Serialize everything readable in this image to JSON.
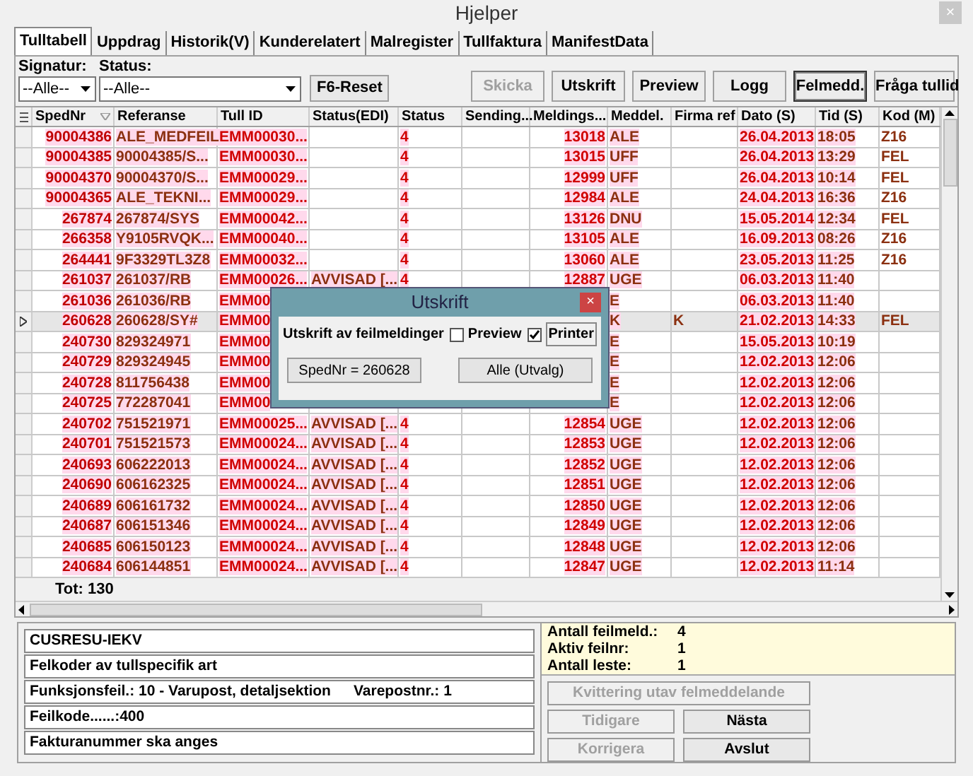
{
  "window": {
    "title": "Hjelper",
    "close": "×"
  },
  "tabs": [
    {
      "label": "Tulltabell",
      "selected": true
    },
    {
      "label": "Uppdrag",
      "selected": false
    },
    {
      "label": "Historik(V)",
      "selected": false
    },
    {
      "label": "Kunderelatert",
      "selected": false
    },
    {
      "label": "Malregister",
      "selected": false
    },
    {
      "label": "Tullfaktura",
      "selected": false
    },
    {
      "label": "ManifestData",
      "selected": false
    }
  ],
  "filters": {
    "signatur": {
      "label": "Signatur:",
      "value": "--Alle--"
    },
    "status": {
      "label": "Status:",
      "value": "--Alle--"
    },
    "reset_button": "F6-Reset"
  },
  "toolbar": [
    {
      "label": "Skicka",
      "disabled": true,
      "pressed": false
    },
    {
      "label": "Utskrift",
      "disabled": false,
      "pressed": false
    },
    {
      "label": "Preview",
      "disabled": false,
      "pressed": false
    },
    {
      "label": "Logg",
      "disabled": false,
      "pressed": false
    },
    {
      "label": "Felmedd.",
      "disabled": false,
      "pressed": true
    },
    {
      "label": "Fråga tullid",
      "disabled": false,
      "pressed": false
    }
  ],
  "table": {
    "columns": [
      "SpedNr",
      "Referanse",
      "Tull ID",
      "Status(EDI)",
      "Status",
      "Sending...",
      "Meldings...",
      "Meddel.",
      "Firma ref",
      "Dato (S)",
      "Tid (S)",
      "Kod (M)"
    ],
    "rows": [
      {
        "selected": false,
        "sped_nr": "90004386",
        "referanse": "ALE_MEDFEIL",
        "tull_id": "EMM00030...",
        "status": "4",
        "meldings": "13018",
        "meddel": "ALE",
        "dato": "26.04.2013",
        "tid": "18:05",
        "kod": "Z16"
      },
      {
        "selected": false,
        "sped_nr": "90004385",
        "referanse": "90004385/S...",
        "tull_id": "EMM00030...",
        "status": "4",
        "meldings": "13015",
        "meddel": "UFF",
        "dato": "26.04.2013",
        "tid": "13:29",
        "kod": "FEL"
      },
      {
        "selected": false,
        "sped_nr": "90004370",
        "referanse": "90004370/S...",
        "tull_id": "EMM00029...",
        "status": "4",
        "meldings": "12999",
        "meddel": "UFF",
        "dato": "26.04.2013",
        "tid": "10:14",
        "kod": "FEL"
      },
      {
        "selected": false,
        "sped_nr": "90004365",
        "referanse": "ALE_TEKNI...",
        "tull_id": "EMM00029...",
        "status": "4",
        "meldings": "12984",
        "meddel": "ALE",
        "dato": "24.04.2013",
        "tid": "16:36",
        "kod": "Z16"
      },
      {
        "selected": false,
        "sped_nr": "267874",
        "referanse": "267874/SYS",
        "tull_id": "EMM00042...",
        "status": "4",
        "meldings": "13126",
        "meddel": "DNU",
        "dato": "15.05.2014",
        "tid": "12:34",
        "kod": "FEL"
      },
      {
        "selected": false,
        "sped_nr": "266358",
        "referanse": "Y9105RVQK...",
        "tull_id": "EMM00040...",
        "status": "4",
        "meldings": "13105",
        "meddel": "ALE",
        "dato": "16.09.2013",
        "tid": "08:26",
        "kod": "Z16"
      },
      {
        "selected": false,
        "sped_nr": "264441",
        "referanse": "9F3329TL3Z8",
        "tull_id": "EMM00032...",
        "status": "4",
        "meldings": "13060",
        "meddel": "ALE",
        "dato": "23.05.2013",
        "tid": "11:25",
        "kod": "Z16"
      },
      {
        "selected": false,
        "sped_nr": "261037",
        "referanse": "261037/RB",
        "tull_id": "EMM00026...",
        "status_edi": "AVVISAD [...",
        "status": "4",
        "meldings": "12887",
        "meddel": "UGE",
        "dato": "06.03.2013",
        "tid": "11:40"
      },
      {
        "selected": false,
        "sped_nr": "261036",
        "referanse": "261036/RB",
        "tull_id": "EMM00",
        "meddel": "E",
        "dato": "06.03.2013",
        "tid": "11:40"
      },
      {
        "selected": true,
        "sped_nr": "260628",
        "referanse": "260628/SY#",
        "tull_id": "EMM00",
        "meddel": "K",
        "firma_ref": "K",
        "dato": "21.02.2013",
        "tid": "14:33",
        "kod": "FEL"
      },
      {
        "selected": false,
        "sped_nr": "240730",
        "referanse": "829324971",
        "tull_id": "EMM00",
        "meddel": "E",
        "dato": "15.05.2013",
        "tid": "10:19"
      },
      {
        "selected": false,
        "sped_nr": "240729",
        "referanse": "829324945",
        "tull_id": "EMM00",
        "meddel": "E",
        "dato": "12.02.2013",
        "tid": "12:06"
      },
      {
        "selected": false,
        "sped_nr": "240728",
        "referanse": "811756438",
        "tull_id": "EMM00",
        "meddel": "E",
        "dato": "12.02.2013",
        "tid": "12:06"
      },
      {
        "selected": false,
        "sped_nr": "240725",
        "referanse": "772287041",
        "tull_id": "EMM00",
        "meddel": "E",
        "dato": "12.02.2013",
        "tid": "12:06"
      },
      {
        "selected": false,
        "sped_nr": "240702",
        "referanse": "751521971",
        "tull_id": "EMM00025...",
        "status_edi": "AVVISAD [...",
        "status": "4",
        "meldings": "12854",
        "meddel": "UGE",
        "dato": "12.02.2013",
        "tid": "12:06"
      },
      {
        "selected": false,
        "sped_nr": "240701",
        "referanse": "751521573",
        "tull_id": "EMM00024...",
        "status_edi": "AVVISAD [...",
        "status": "4",
        "meldings": "12853",
        "meddel": "UGE",
        "dato": "12.02.2013",
        "tid": "12:06"
      },
      {
        "selected": false,
        "sped_nr": "240693",
        "referanse": "606222013",
        "tull_id": "EMM00024...",
        "status_edi": "AVVISAD [...",
        "status": "4",
        "meldings": "12852",
        "meddel": "UGE",
        "dato": "12.02.2013",
        "tid": "12:06"
      },
      {
        "selected": false,
        "sped_nr": "240690",
        "referanse": "606162325",
        "tull_id": "EMM00024...",
        "status_edi": "AVVISAD [...",
        "status": "4",
        "meldings": "12851",
        "meddel": "UGE",
        "dato": "12.02.2013",
        "tid": "12:06"
      },
      {
        "selected": false,
        "sped_nr": "240689",
        "referanse": "606161732",
        "tull_id": "EMM00024...",
        "status_edi": "AVVISAD [...",
        "status": "4",
        "meldings": "12850",
        "meddel": "UGE",
        "dato": "12.02.2013",
        "tid": "12:06"
      },
      {
        "selected": false,
        "sped_nr": "240687",
        "referanse": "606151346",
        "tull_id": "EMM00024...",
        "status_edi": "AVVISAD [...",
        "status": "4",
        "meldings": "12849",
        "meddel": "UGE",
        "dato": "12.02.2013",
        "tid": "12:06"
      },
      {
        "selected": false,
        "sped_nr": "240685",
        "referanse": "606150123",
        "tull_id": "EMM00024...",
        "status_edi": "AVVISAD [...",
        "status": "4",
        "meldings": "12848",
        "meddel": "UGE",
        "dato": "12.02.2013",
        "tid": "12:06"
      },
      {
        "selected": false,
        "sped_nr": "240684",
        "referanse": "606144851",
        "tull_id": "EMM00024...",
        "status_edi": "AVVISAD [...",
        "status": "4",
        "meldings": "12847",
        "meddel": "UGE",
        "dato": "12.02.2013",
        "tid": "11:14"
      }
    ],
    "total": "Tot: 130"
  },
  "dialog": {
    "title": "Utskrift",
    "close": "×",
    "label": "Utskrift av feilmeldinger",
    "options": [
      {
        "label": "Preview",
        "checked": false
      },
      {
        "label": "Printer",
        "checked": true
      }
    ],
    "buttons": [
      "SpedNr = 260628",
      "Alle (Utvalg)"
    ]
  },
  "messages": [
    {
      "text": "CUSRESU-IEKV"
    },
    {
      "text": "Felkoder av tullspecifik art"
    },
    {
      "text": "Funksjonsfeil.: 10 - Varupost, detaljsektion",
      "extra": "Varepostnr.: 1"
    },
    {
      "text": "Feilkode......:400"
    },
    {
      "text": "Fakturanummer ska anges"
    }
  ],
  "summary": [
    {
      "label": "Antall feilmeld.:",
      "value": "4"
    },
    {
      "label": "Aktiv feilnr:",
      "value": "1"
    },
    {
      "label": "Antall leste:",
      "value": "1"
    }
  ],
  "actions": [
    {
      "kind": "wide",
      "label": "Kvittering utav felmeddelande",
      "disabled": true
    },
    {
      "kind": "half",
      "label": "Tidigare",
      "disabled": true
    },
    {
      "kind": "half",
      "label": "Nästa",
      "disabled": false
    },
    {
      "kind": "half",
      "label": "Korrigera",
      "disabled": true
    },
    {
      "kind": "half",
      "label": "Avslut",
      "disabled": false
    }
  ]
}
